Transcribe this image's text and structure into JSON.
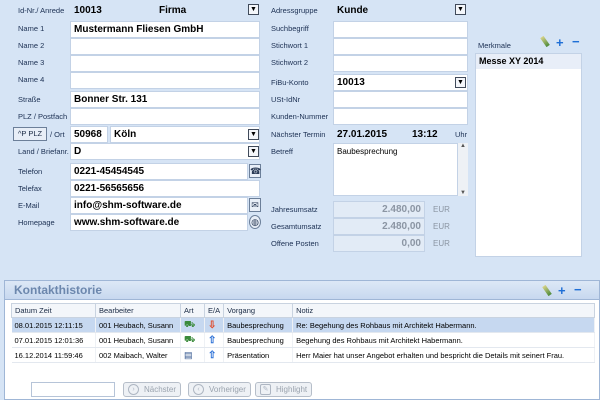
{
  "left": {
    "id_label": "Id-Nr./ Anrede",
    "id_value": "10013",
    "anrede_value": "Firma",
    "name1_label": "Name 1",
    "name1_value": "Mustermann Fliesen GmbH",
    "name2_label": "Name 2",
    "name3_label": "Name 3",
    "name4_label": "Name 4",
    "strasse_label": "Straße",
    "strasse_value": "Bonner Str. 131",
    "plz_postfach_label": "PLZ / Postfach",
    "plz_button": "^P PLZ",
    "ort_label": "/ Ort",
    "plz_value": "50968",
    "ort_value": "Köln",
    "land_label": "Land / Briefanr.",
    "land_value": "D",
    "telefon_label": "Telefon",
    "telefon_value": "0221-45454545",
    "telefax_label": "Telefax",
    "telefax_value": "0221-56565656",
    "email_label": "E-Mail",
    "email_value": "info@shm-software.de",
    "homepage_label": "Homepage",
    "homepage_value": "www.shm-software.de"
  },
  "right": {
    "adressgruppe_label": "Adressgruppe",
    "adressgruppe_value": "Kunde",
    "suchbegriff_label": "Suchbegriff",
    "stichwort1_label": "Stichwort 1",
    "stichwort2_label": "Stichwort 2",
    "fibu_label": "FiBu-Konto",
    "fibu_value": "10013",
    "ustid_label": "USt-IdNr",
    "kundennummer_label": "Kunden-Nummer",
    "termin_label": "Nächster Termin",
    "termin_date": "27.01.2015",
    "termin_time": "13:12",
    "termin_unit": "Uhr",
    "betreff_label": "Betreff",
    "betreff_value": "Baubesprechung",
    "jahresumsatz_label": "Jahresumsatz",
    "jahresumsatz_value": "2.480,00",
    "jahresumsatz_cur": "EUR",
    "gesamtumsatz_label": "Gesamtumsatz",
    "gesamtumsatz_value": "2.480,00",
    "gesamtumsatz_cur": "EUR",
    "offene_label": "Offene Posten",
    "offene_value": "0,00",
    "offene_cur": "EUR"
  },
  "merkmale": {
    "label": "Merkmale",
    "items": [
      "Messe XY 2014"
    ]
  },
  "kontakt": {
    "title": "Kontakthistorie",
    "headers": [
      "Datum Zeit",
      "Bearbeiter",
      "Art",
      "E/A",
      "Vorgang",
      "Notiz"
    ],
    "rows": [
      {
        "datum": "08.01.2015 12:11:15",
        "bearbeiter": "001 Heubach, Susann",
        "vorgang": "Baubesprechung",
        "notiz": "Re: Begehung des Rohbaus mit Architekt Habermann."
      },
      {
        "datum": "07.01.2015 12:01:36",
        "bearbeiter": "001 Heubach, Susann",
        "vorgang": "Baubesprechung",
        "notiz": "Begehung des Rohbaus mit Architekt Habermann."
      },
      {
        "datum": "16.12.2014 11:59:46",
        "bearbeiter": "002 Maibach, Walter",
        "vorgang": "Präsentation",
        "notiz": "Herr Maier hat unser Angebot erhalten und bespricht die Details mit seinert Frau."
      }
    ],
    "btn_next": "Nächster",
    "btn_prev": "Vorheriger",
    "btn_highlight": "Highlight"
  },
  "colors": {
    "bg": "#d6e4f5",
    "selected_row": "#c6d8f0",
    "accent": "#1f6fd6"
  }
}
